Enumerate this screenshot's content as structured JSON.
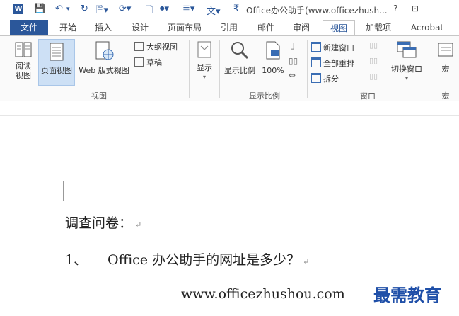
{
  "window": {
    "title": "Office办公助手(www.officezhush...",
    "app_icon": "W",
    "help": "?",
    "restore_btn": "⊡",
    "minimize_btn": "—"
  },
  "qat": {
    "save": "💾",
    "undo": "↶",
    "undo_caret": "▾",
    "redo": "↻",
    "icons": [
      "🗎▾",
      "⟳▾",
      "🗋",
      "⏺▾",
      "≣▾",
      "文▾",
      "₹"
    ]
  },
  "tabs": [
    {
      "label": "文件"
    },
    {
      "label": "开始"
    },
    {
      "label": "插入"
    },
    {
      "label": "设计"
    },
    {
      "label": "页面布局"
    },
    {
      "label": "引用"
    },
    {
      "label": "邮件"
    },
    {
      "label": "审阅"
    },
    {
      "label": "视图"
    },
    {
      "label": "加载项"
    },
    {
      "label": "Acrobat"
    }
  ],
  "ribbon": {
    "views": {
      "read_mode": "阅读视图",
      "print_layout": "页面视图",
      "web_layout": "Web 版式视图",
      "outline": "大纲视图",
      "draft": "草稿",
      "group_label": "视图"
    },
    "show": {
      "label": "显示"
    },
    "zoom": {
      "zoom": "显示比例",
      "hundred": "100%",
      "group_label": "显示比例"
    },
    "window": {
      "new_window": "新建窗口",
      "arrange_all": "全部重排",
      "split": "拆分",
      "switch_windows": "切换窗口",
      "group_label": "窗口"
    },
    "macros": {
      "label": "宏",
      "group_label": "宏"
    }
  },
  "document": {
    "heading": "调查问卷：",
    "q_number": "1、",
    "q_text": "Office 办公助手的网址是多少？",
    "answer": "www.officezhushou.com",
    "para_mark": "↵"
  },
  "watermark": "最需教育",
  "colors": {
    "accent": "#2b579a",
    "watermark": "#1f4fa8"
  }
}
